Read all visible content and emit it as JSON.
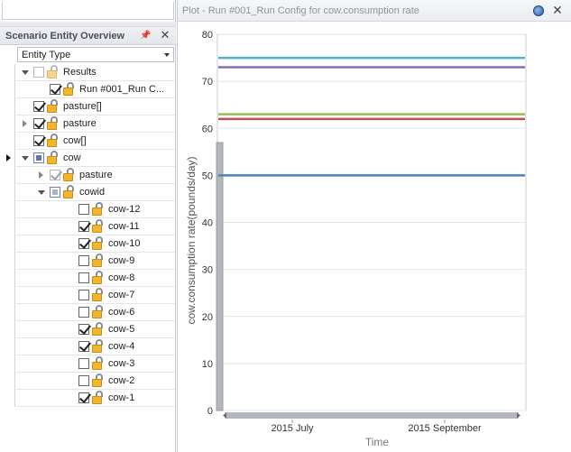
{
  "left_pane": {
    "title": "Scenario Entity Overview",
    "pin_glyph": "ᵖ",
    "close_glyph": "✕",
    "column_header": "Entity Type",
    "rows": [
      {
        "label": "Results",
        "indent": 0,
        "expander": "open",
        "check": "none",
        "dim": true
      },
      {
        "label": "Run #001_Run C...",
        "indent": 1,
        "expander": "none",
        "check": "on",
        "dim": false
      },
      {
        "label": "pasture[]",
        "indent": 0,
        "expander": "none",
        "check": "on",
        "dim": false
      },
      {
        "label": "pasture",
        "indent": 0,
        "expander": "closed",
        "check": "on",
        "dim": false
      },
      {
        "label": "cow[]",
        "indent": 0,
        "expander": "none",
        "check": "on",
        "dim": false
      },
      {
        "label": "cow",
        "indent": 0,
        "expander": "open",
        "check": "partial",
        "dim": false,
        "current": true
      },
      {
        "label": "pasture",
        "indent": 1,
        "expander": "closed",
        "check": "on",
        "dim": true
      },
      {
        "label": "cowid",
        "indent": 1,
        "expander": "open",
        "check": "partial",
        "dim": true
      },
      {
        "label": "cow-12",
        "indent": 2,
        "expander": "none",
        "check": "off",
        "dim": false
      },
      {
        "label": "cow-11",
        "indent": 2,
        "expander": "none",
        "check": "on",
        "dim": false
      },
      {
        "label": "cow-10",
        "indent": 2,
        "expander": "none",
        "check": "on",
        "dim": false
      },
      {
        "label": "cow-9",
        "indent": 2,
        "expander": "none",
        "check": "off",
        "dim": false
      },
      {
        "label": "cow-8",
        "indent": 2,
        "expander": "none",
        "check": "off",
        "dim": false
      },
      {
        "label": "cow-7",
        "indent": 2,
        "expander": "none",
        "check": "off",
        "dim": false
      },
      {
        "label": "cow-6",
        "indent": 2,
        "expander": "none",
        "check": "off",
        "dim": false
      },
      {
        "label": "cow-5",
        "indent": 2,
        "expander": "none",
        "check": "on",
        "dim": false
      },
      {
        "label": "cow-4",
        "indent": 2,
        "expander": "none",
        "check": "on",
        "dim": false
      },
      {
        "label": "cow-3",
        "indent": 2,
        "expander": "none",
        "check": "off",
        "dim": false
      },
      {
        "label": "cow-2",
        "indent": 2,
        "expander": "none",
        "check": "off",
        "dim": false
      },
      {
        "label": "cow-1",
        "indent": 2,
        "expander": "none",
        "check": "on",
        "dim": false
      }
    ]
  },
  "plot_window": {
    "title": "Plot - Run #001_Run Config for cow.consumption rate",
    "close_glyph": "✕",
    "icons": [
      "globe-icon"
    ]
  },
  "chart_data": {
    "type": "line",
    "xlabel": "Time",
    "ylabel": "cow.consumption rate(pounds/day)",
    "ylim": [
      0,
      80
    ],
    "yticks": [
      0,
      10,
      20,
      30,
      40,
      50,
      60,
      70,
      80
    ],
    "xtick_labels": [
      "2015 July",
      "2015 September"
    ],
    "grid": true,
    "series": [
      {
        "values": [
          75,
          75
        ],
        "color": "#4fb3c6"
      },
      {
        "values": [
          73,
          73
        ],
        "color": "#8c6bb1"
      },
      {
        "values": [
          63,
          63
        ],
        "color": "#9bbb59"
      },
      {
        "values": [
          62,
          62
        ],
        "color": "#c0504d"
      },
      {
        "values": [
          50,
          50
        ],
        "color": "#4f81bd"
      }
    ]
  }
}
